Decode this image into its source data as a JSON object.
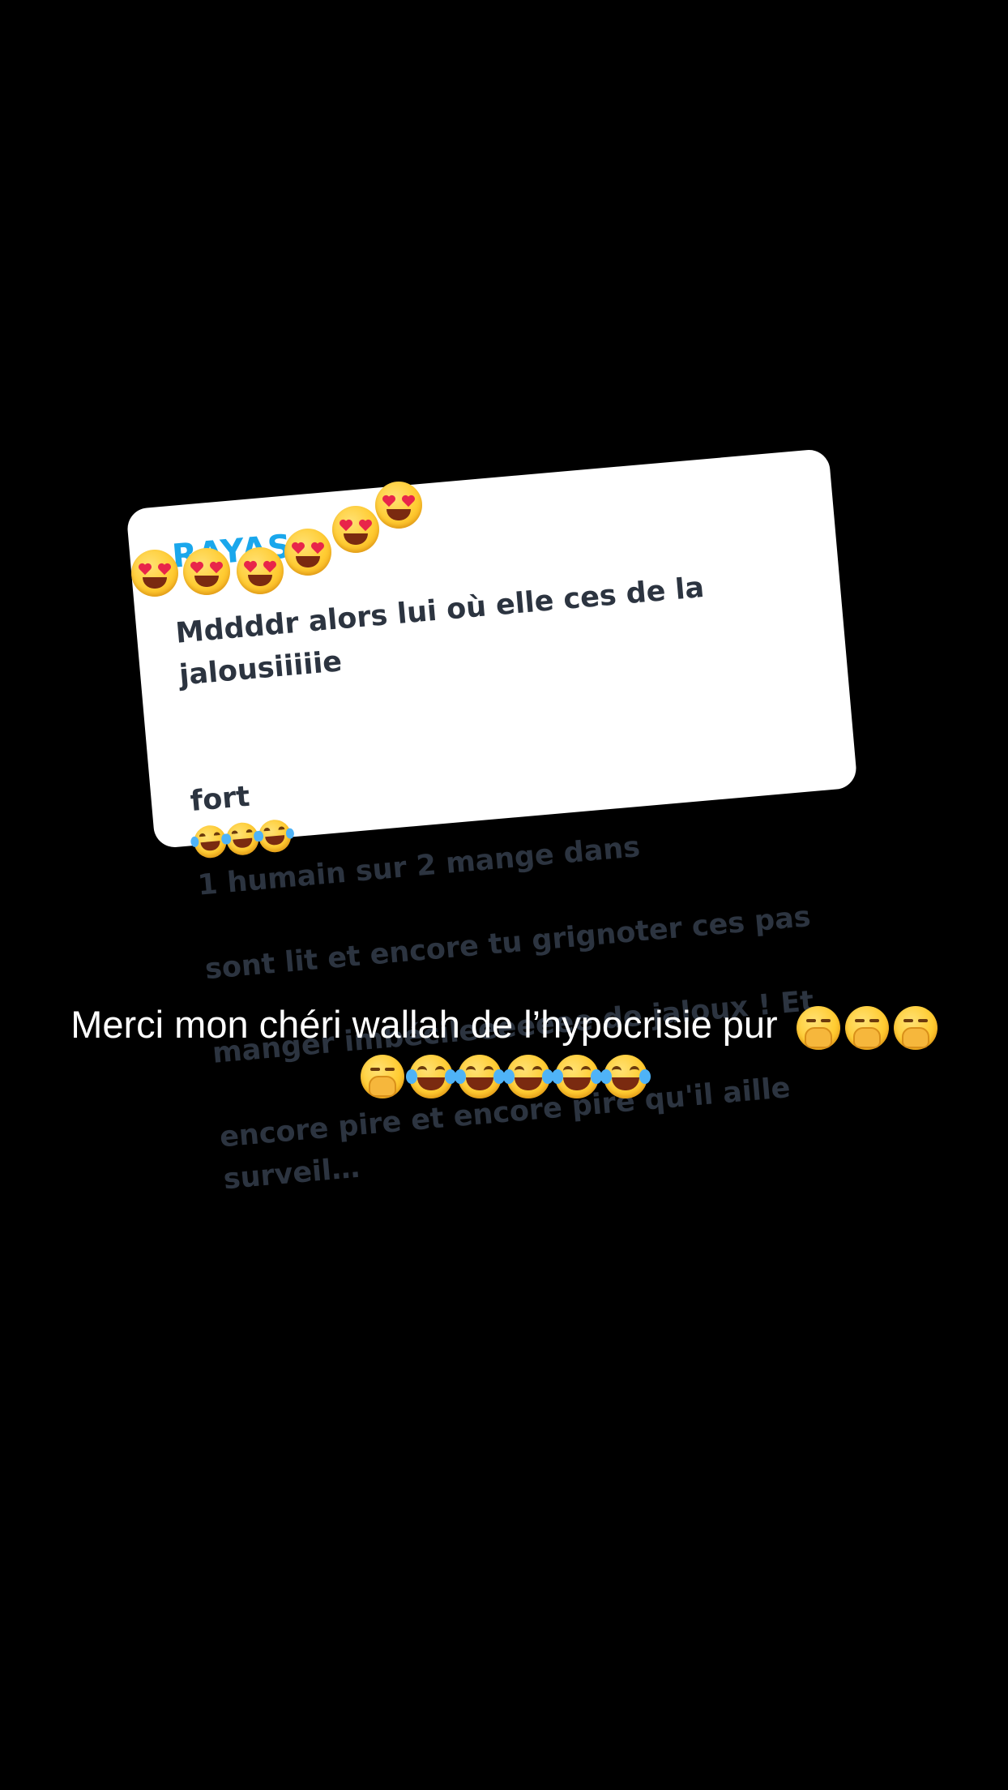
{
  "comment_card": {
    "username": "RAYAS",
    "text_line1": "Mddddr alors lui où elle ces de la jalousiiiiie",
    "text_line2_before": "fort",
    "text_line2_after": "1 humain sur 2 mange dans",
    "text_line3": "sont lit et encore tu grignoter ces pas",
    "text_line4": "manger imbécileeeeeee de jaloux ! Et",
    "text_line5": "encore pire et encore pire qu'il aille surveil…",
    "inline_emojis": [
      "laugh-cry-icon",
      "laugh-cry-icon",
      "laugh-cry-icon"
    ]
  },
  "sticker_emojis": [
    "heart-eyes-icon",
    "heart-eyes-icon",
    "heart-eyes-icon",
    "heart-eyes-icon",
    "heart-eyes-icon",
    "heart-eyes-icon"
  ],
  "caption": {
    "text": "Merci mon chéri wallah de l’hypocrisie pur",
    "line1_emojis": [
      "yawn-icon",
      "yawn-icon",
      "yawn-icon"
    ],
    "line2_emojis": [
      "yawn-icon",
      "laugh-cry-icon",
      "laugh-cry-icon",
      "laugh-cry-icon",
      "laugh-cry-icon",
      "laugh-cry-icon"
    ]
  },
  "colors": {
    "background": "#000000",
    "card": "#ffffff",
    "username": "#1aa7ec",
    "card_text": "#2c3440",
    "caption_text": "#ffffff"
  }
}
